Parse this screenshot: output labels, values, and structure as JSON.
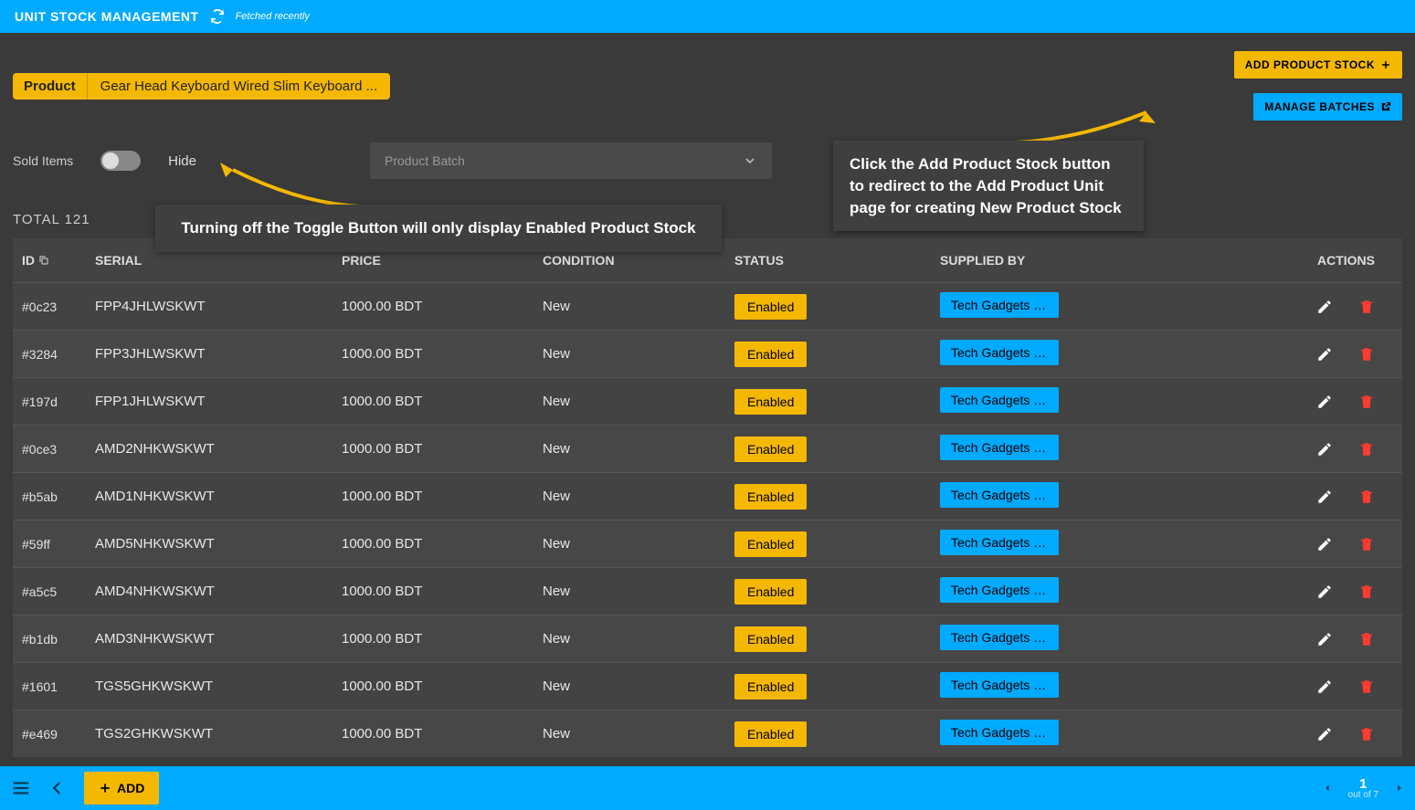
{
  "header": {
    "title": "UNIT STOCK MANAGEMENT",
    "fetched": "Fetched recently"
  },
  "product": {
    "label": "Product",
    "value": "Gear Head Keyboard Wired Slim Keyboard ..."
  },
  "buttons": {
    "add_product_stock": "ADD PRODUCT STOCK",
    "manage_batches": "MANAGE BATCHES",
    "add": "ADD"
  },
  "filters": {
    "sold_items": "Sold Items",
    "hide": "Hide",
    "batch_placeholder": "Product Batch"
  },
  "annotations": {
    "toggle_note": "Turning off the Toggle Button will only display Enabled Product Stock",
    "add_note": "Click the Add Product Stock button to redirect to the Add Product Unit page for creating New Product Stock"
  },
  "total_label": "TOTAL 121",
  "columns": {
    "id": "ID",
    "serial": "SERIAL",
    "price": "PRICE",
    "condition": "CONDITION",
    "status": "STATUS",
    "supplied_by": "SUPPLIED BY",
    "actions": "ACTIONS"
  },
  "rows": [
    {
      "id": "#0c23",
      "serial": "FPP4JHLWSKWT",
      "price": "1000.00 BDT",
      "condition": "New",
      "status": "Enabled",
      "supplier": "Tech Gadgets Su..."
    },
    {
      "id": "#3284",
      "serial": "FPP3JHLWSKWT",
      "price": "1000.00 BDT",
      "condition": "New",
      "status": "Enabled",
      "supplier": "Tech Gadgets Su..."
    },
    {
      "id": "#197d",
      "serial": "FPP1JHLWSKWT",
      "price": "1000.00 BDT",
      "condition": "New",
      "status": "Enabled",
      "supplier": "Tech Gadgets Su..."
    },
    {
      "id": "#0ce3",
      "serial": "AMD2NHKWSKWT",
      "price": "1000.00 BDT",
      "condition": "New",
      "status": "Enabled",
      "supplier": "Tech Gadgets Su..."
    },
    {
      "id": "#b5ab",
      "serial": "AMD1NHKWSKWT",
      "price": "1000.00 BDT",
      "condition": "New",
      "status": "Enabled",
      "supplier": "Tech Gadgets Su..."
    },
    {
      "id": "#59ff",
      "serial": "AMD5NHKWSKWT",
      "price": "1000.00 BDT",
      "condition": "New",
      "status": "Enabled",
      "supplier": "Tech Gadgets Su..."
    },
    {
      "id": "#a5c5",
      "serial": "AMD4NHKWSKWT",
      "price": "1000.00 BDT",
      "condition": "New",
      "status": "Enabled",
      "supplier": "Tech Gadgets Su..."
    },
    {
      "id": "#b1db",
      "serial": "AMD3NHKWSKWT",
      "price": "1000.00 BDT",
      "condition": "New",
      "status": "Enabled",
      "supplier": "Tech Gadgets Su..."
    },
    {
      "id": "#1601",
      "serial": "TGS5GHKWSKWT",
      "price": "1000.00 BDT",
      "condition": "New",
      "status": "Enabled",
      "supplier": "Tech Gadgets Su..."
    },
    {
      "id": "#e469",
      "serial": "TGS2GHKWSKWT",
      "price": "1000.00 BDT",
      "condition": "New",
      "status": "Enabled",
      "supplier": "Tech Gadgets Su..."
    }
  ],
  "pager": {
    "page": "1",
    "out_of": "out of 7"
  }
}
